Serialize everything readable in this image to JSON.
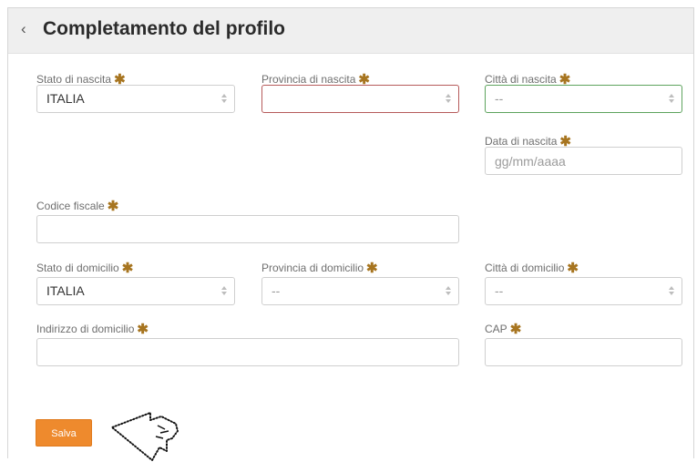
{
  "header": {
    "back_icon": "chevron-left-icon",
    "back_symbol": "‹",
    "title": "Completamento del profilo"
  },
  "required_mark": "✱",
  "colors": {
    "accent": "#ee8a2d",
    "required_star": "#a77520",
    "error_border": "#b65a5a",
    "valid_border": "#5da35d"
  },
  "birth": {
    "stato": {
      "label": "Stato di nascita",
      "value": "ITALIA"
    },
    "provincia": {
      "label": "Provincia di nascita",
      "value": "",
      "state": "error"
    },
    "citta": {
      "label": "Città di nascita",
      "value": "--",
      "state": "valid"
    },
    "data": {
      "label": "Data di nascita",
      "placeholder": "gg/mm/aaaa",
      "value": ""
    }
  },
  "codice_fiscale": {
    "label": "Codice fiscale",
    "value": ""
  },
  "domicile": {
    "stato": {
      "label": "Stato di domicilio",
      "value": "ITALIA"
    },
    "provincia": {
      "label": "Provincia di domicilio",
      "value": "--"
    },
    "citta": {
      "label": "Città di domicilio",
      "value": "--"
    },
    "indirizzo": {
      "label": "Indirizzo di domicilio",
      "value": ""
    },
    "cap": {
      "label": "CAP",
      "value": ""
    }
  },
  "actions": {
    "save_label": "Salva"
  },
  "pointer": {
    "icon": "pointer-cursor-icon"
  }
}
